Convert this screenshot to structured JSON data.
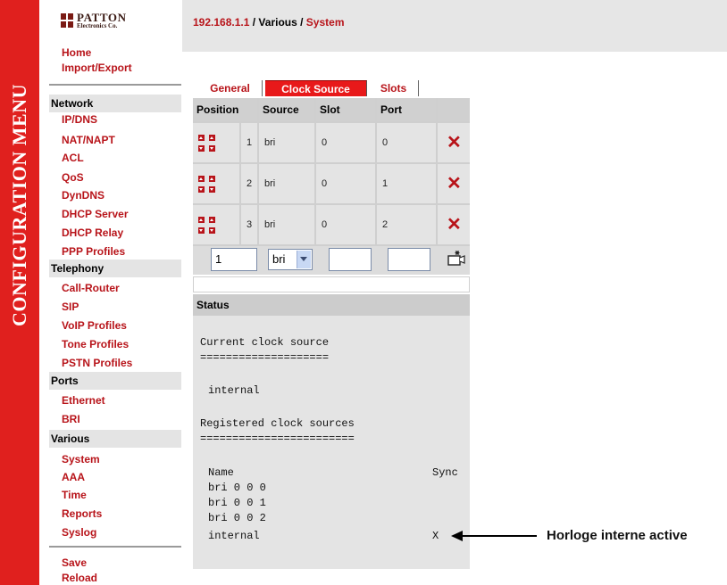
{
  "sidebar_title": "CONFIGURATION MENU",
  "logo": {
    "name": "PATTON",
    "sub": "Electronics Co."
  },
  "breadcrumb": {
    "host": "192.168.1.1",
    "sep1": " / ",
    "section": "Various",
    "sep2": " / ",
    "page": "System"
  },
  "menu": {
    "home": "Home",
    "import_export": "Import/Export",
    "network": {
      "title": "Network",
      "items": [
        "IP/DNS",
        "NAT/NAPT",
        "ACL",
        "QoS",
        "DynDNS",
        "DHCP Server",
        "DHCP Relay",
        "PPP Profiles"
      ]
    },
    "telephony": {
      "title": "Telephony",
      "items": [
        "Call-Router",
        "SIP",
        "VoIP Profiles",
        "Tone Profiles",
        "PSTN Profiles"
      ]
    },
    "ports": {
      "title": "Ports",
      "items": [
        "Ethernet",
        "BRI"
      ]
    },
    "various": {
      "title": "Various",
      "items": [
        "System",
        "AAA",
        "Time",
        "Reports",
        "Syslog"
      ]
    },
    "save": "Save",
    "reload": "Reload"
  },
  "tabs": [
    "General",
    "Clock Source",
    "Slots"
  ],
  "active_tab": "Clock Source",
  "table": {
    "headers": [
      "Position",
      "Source",
      "Slot",
      "Port"
    ],
    "rows": [
      {
        "position": "1",
        "source": "bri",
        "slot": "0",
        "port": "0"
      },
      {
        "position": "2",
        "source": "bri",
        "slot": "0",
        "port": "1"
      },
      {
        "position": "3",
        "source": "bri",
        "slot": "0",
        "port": "2"
      }
    ],
    "new_row": {
      "position": "1",
      "source": "bri",
      "slot": "",
      "port": ""
    }
  },
  "status": {
    "title": "Status",
    "current_heading": "Current clock source",
    "current_rule": "====================",
    "current_value": "internal",
    "registered_heading": "Registered clock sources",
    "registered_rule": "========================",
    "col_name": "Name",
    "col_sync": "Sync",
    "entries": [
      {
        "name": "bri 0 0 0",
        "sync": ""
      },
      {
        "name": "bri 0 0 1",
        "sync": ""
      },
      {
        "name": "bri 0 0 2",
        "sync": ""
      },
      {
        "name": "internal",
        "sync": "X"
      }
    ]
  },
  "annotation": "Horloge interne active",
  "colors": {
    "accent_red": "#e0201e",
    "link_red": "#b8141a",
    "panel_gray": "#e4e4e4"
  }
}
